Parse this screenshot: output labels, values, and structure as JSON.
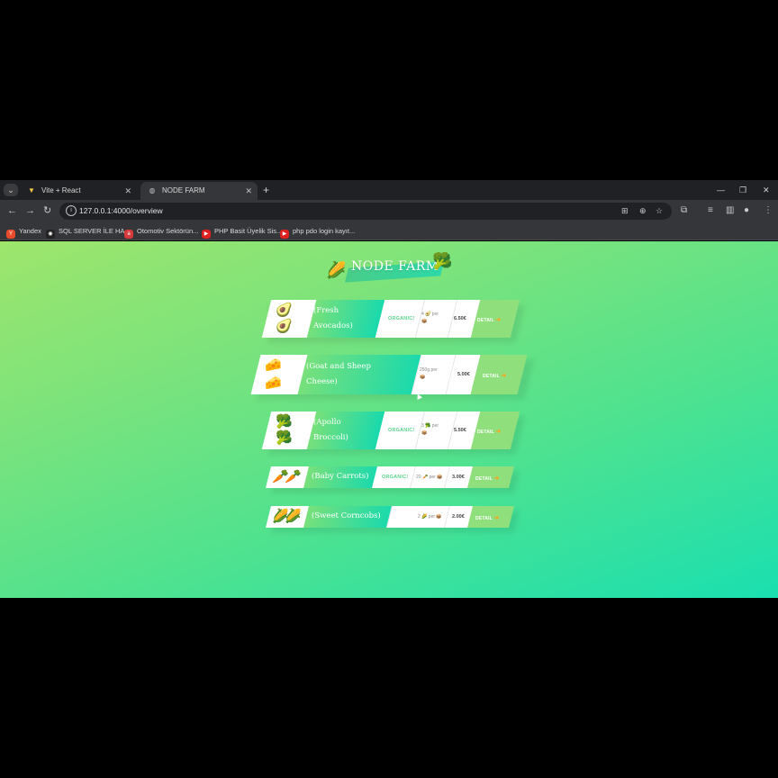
{
  "tabs": [
    {
      "title": "Vite + React",
      "favicon": "vite-icon",
      "active": false
    },
    {
      "title": "NODE FARM",
      "favicon": "globe-icon",
      "active": true
    }
  ],
  "address_bar": {
    "url": "127.0.0.1:4000/overview"
  },
  "bookmarks": [
    {
      "label": "Yandex",
      "color": "#f33"
    },
    {
      "label": "SQL SERVER İLE HA...",
      "color": "#222"
    },
    {
      "label": "Otomotiv Sektörün...",
      "color": "#e33"
    },
    {
      "label": "PHP Basit Üyelik Sis...",
      "color": "#e22"
    },
    {
      "label": "php pdo login kayıt...",
      "color": "#e22"
    }
  ],
  "brand": {
    "name": "NODE FARM",
    "left_icon": "🌽",
    "right_icon": "🥦"
  },
  "products": [
    {
      "emoji": "🥑",
      "name_line1": "(Fresh",
      "name_line2": "Avocados)",
      "organic": "ORGANIC!",
      "qty": "4 🥑 per",
      "qty2": "📦",
      "price": "6.50€",
      "detail": "DETAIL"
    },
    {
      "emoji": "🧀",
      "name_line1": "(Goat and Sheep",
      "name_line2": "Cheese)",
      "organic": "",
      "qty": "250g per",
      "qty2": "📦",
      "price": "5.00€",
      "detail": "DETAIL"
    },
    {
      "emoji": "🥦",
      "name_line1": "(Apollo",
      "name_line2": "Broccoli)",
      "organic": "ORGANIC!",
      "qty": "3 🥦 per",
      "qty2": "📦",
      "price": "5.50€",
      "detail": "DETAIL"
    },
    {
      "emoji": "🥕",
      "name_line1": "(Baby Carrots)",
      "name_line2": "",
      "organic": "ORGANIC!",
      "qty": "20 🥕 per 📦",
      "qty2": "",
      "price": "3.00€",
      "detail": "DETAIL"
    },
    {
      "emoji": "🌽",
      "name_line1": "(Sweet Corncobs)",
      "name_line2": "",
      "organic": "",
      "qty": "2 🌽 per 📦",
      "qty2": "",
      "price": "2.00€",
      "detail": "DETAIL"
    }
  ],
  "icons": {
    "detail_arrow": "➜"
  },
  "colors": {
    "accent_green": "#5cd48e",
    "gradient_start": "#9ee56c",
    "gradient_end": "#1adfb0"
  }
}
